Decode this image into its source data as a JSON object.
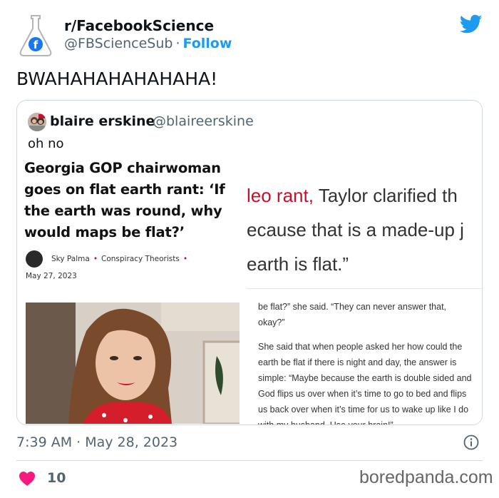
{
  "account": {
    "name": "r/FacebookScience",
    "handle": "@FBScienceSub",
    "separator": "·",
    "follow_label": "Follow"
  },
  "tweet": {
    "text": "BWAHAHAHAHAHAHA!",
    "timestamp": "7:39 AM · May 28, 2023",
    "likes": "10"
  },
  "quoted_tweet": {
    "name": "blaire erskine",
    "handle": "@blaireerskine",
    "text": "oh no"
  },
  "article": {
    "headline": "Georgia GOP chairwoman goes on flat earth rant: ‘If the earth was round, why would maps be flat?’",
    "author": "Sky Palma",
    "category": "Conspiracy Theorists",
    "bullet": "•",
    "date": "May 27, 2023",
    "quote_line_1_red": "leo rant,",
    "quote_line_1_rest": " Taylor clarified th",
    "quote_line_2": "ecause that is a made-up j",
    "quote_line_3": "earth is flat.”",
    "para_1": "be flat?” she said. “They can never answer that, okay?”",
    "para_2": "She said that when people asked her how could the earth be flat if there is night and day, the answer is simple: “Maybe because the earth is double sided and God flips us over when it’s time to go to bed and flips us back over when it’s time for us to wake up like I do with my husband. Use your brain!”"
  },
  "watermark": "boredpanda.com",
  "colors": {
    "twitter_blue": "#1d9bf0",
    "heart_red": "#f91880",
    "text_secondary": "#536471",
    "accent_red": "#c8102e"
  },
  "icons": {
    "logo": "flask-facebook-icon",
    "brand": "twitter-bird-icon",
    "info": "info-icon",
    "like": "heart-icon"
  }
}
